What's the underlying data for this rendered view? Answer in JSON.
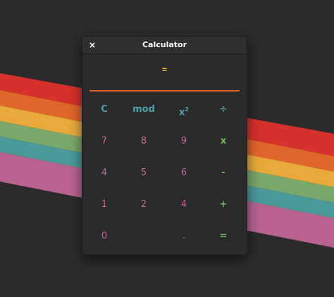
{
  "window": {
    "title": "Calculator",
    "close_label": "×"
  },
  "display": {
    "text": "="
  },
  "keys": {
    "clear": "C",
    "mod": "mod",
    "square_base": "x",
    "square_exp": "2",
    "divide": "÷",
    "seven": "7",
    "eight": "8",
    "nine": "9",
    "multiply": "x",
    "four_a": "4",
    "five": "5",
    "six": "6",
    "minus": "-",
    "one": "1",
    "two": "2",
    "four_b": "4",
    "plus": "+",
    "zero": "0",
    "dot": ".",
    "equals": "="
  },
  "colors": {
    "desktop_bg": "#2b2b2b",
    "window_bg": "#2a2a2a",
    "accent_orange": "#e0662a",
    "display_yellow": "#e6b422",
    "function_teal": "#4aa3ad",
    "number_pink": "#c9669b",
    "operator_green": "#6bbf5a",
    "stripe_red": "#d6312b",
    "stripe_orange": "#e0662a",
    "stripe_yellow": "#e6a93a",
    "stripe_green": "#7aa86a",
    "stripe_teal": "#4a9a9a",
    "stripe_pink": "#b8648f"
  }
}
